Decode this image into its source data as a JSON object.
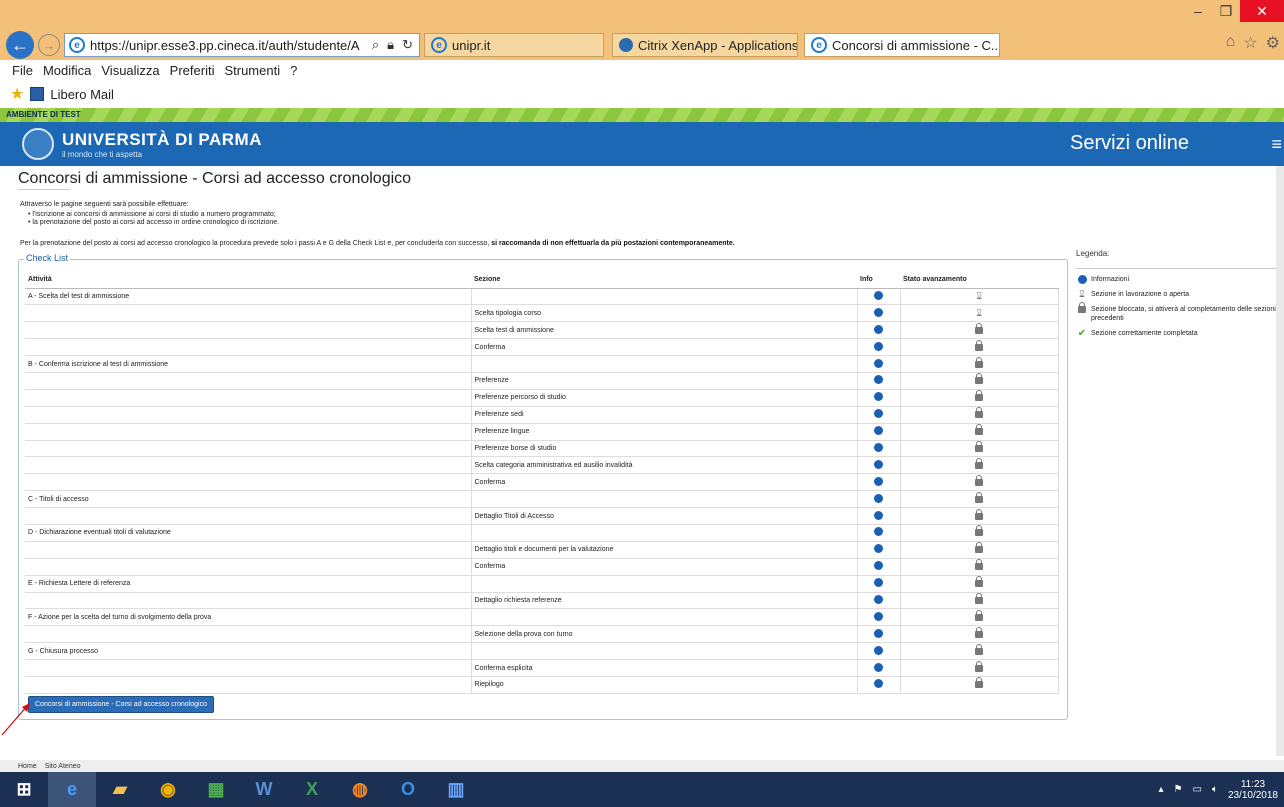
{
  "browser": {
    "url": "https://unipr.esse3.pp.cineca.it/auth/studente/A",
    "tabs": [
      {
        "label": "unipr.it"
      },
      {
        "label": "Citrix XenApp - Applications"
      },
      {
        "label": "Concorsi di ammissione - C...",
        "close": "×"
      }
    ],
    "menu": [
      "File",
      "Modifica",
      "Visualizza",
      "Preferiti",
      "Strumenti",
      "?"
    ],
    "favorite": "Libero Mail"
  },
  "header": {
    "test_banner": "AMBIENTE DI TEST",
    "university": "UNIVERSITÀ DI PARMA",
    "tagline": "il mondo che ti aspetta",
    "services": "Servizi online",
    "brand_color": "#1c68b5"
  },
  "page": {
    "title": "Concorsi di ammissione - Corsi ad accesso cronologico",
    "intro": "Attraverso le pagine seguenti sarà possibile effettuare:",
    "bullets": [
      "l'iscrizione ai concorsi di ammissione ai corsi di studio a numero programmato;",
      "la prenotazione del posto ai corsi ad accesso in ordine cronologico di iscrizione."
    ],
    "note_prefix": "Per la prenotazione del posto ai corsi ad accesso cronologico la procedura prevede solo i passi A e G della Check List e, per concluderla con successo, ",
    "note_bold": "si raccomanda di non effettuarla da più postazioni contemporaneamente.",
    "checklist_label": "Check List",
    "columns": {
      "activity": "Attività",
      "section": "Sezione",
      "info": "Info",
      "status": "Stato avanzamento"
    },
    "rows": [
      {
        "activity": "A - Scelta del test di ammissione",
        "section": "",
        "status": "hourglass"
      },
      {
        "activity": "",
        "section": "Scelta tipologia corso",
        "status": "hourglass"
      },
      {
        "activity": "",
        "section": "Scelta test di ammissione",
        "status": "lock"
      },
      {
        "activity": "",
        "section": "Conferma",
        "status": "lock"
      },
      {
        "activity": "B - Conferma iscrizione al test di ammissione",
        "section": "",
        "status": "lock"
      },
      {
        "activity": "",
        "section": "Preferenze",
        "status": "lock"
      },
      {
        "activity": "",
        "section": "Preferenze percorso di studio",
        "status": "lock"
      },
      {
        "activity": "",
        "section": "Preferenze sedi",
        "status": "lock"
      },
      {
        "activity": "",
        "section": "Preferenze lingue",
        "status": "lock"
      },
      {
        "activity": "",
        "section": "Preferenze borse di studio",
        "status": "lock"
      },
      {
        "activity": "",
        "section": "Scelta categoria amministrativa ed ausilio invalidità",
        "status": "lock"
      },
      {
        "activity": "",
        "section": "Conferma",
        "status": "lock"
      },
      {
        "activity": "C - Titoli di accesso",
        "section": "",
        "status": "lock"
      },
      {
        "activity": "",
        "section": "Dettaglio Titoli di Accesso",
        "status": "lock"
      },
      {
        "activity": "D - Dichiarazione eventuali titoli di valutazione",
        "section": "",
        "status": "lock"
      },
      {
        "activity": "",
        "section": "Dettaglio titoli e documenti per la valutazione",
        "status": "lock"
      },
      {
        "activity": "",
        "section": "Conferma",
        "status": "lock"
      },
      {
        "activity": "E - Richiesta Lettere di referenza",
        "section": "",
        "status": "lock"
      },
      {
        "activity": "",
        "section": "Dettaglio richiesta referenze",
        "status": "lock"
      },
      {
        "activity": "F - Azione per la scelta del turno di svolgimento della prova",
        "section": "",
        "status": "lock"
      },
      {
        "activity": "",
        "section": "Selezione della prova con turno",
        "status": "lock"
      },
      {
        "activity": "G - Chiusura processo",
        "section": "",
        "status": "lock"
      },
      {
        "activity": "",
        "section": "Conferma esplicita",
        "status": "lock"
      },
      {
        "activity": "",
        "section": "Riepilogo",
        "status": "lock"
      }
    ],
    "button": "Concorsi di ammissione - Corsi ad accesso cronologico"
  },
  "legend": {
    "title": "Legenda:",
    "items": [
      {
        "icon": "info-icon",
        "text": "Informazioni"
      },
      {
        "icon": "hourglass-icon",
        "text": "Sezione in lavorazione o aperta"
      },
      {
        "icon": "lock-icon",
        "text": "Sezione bloccata, si attiverà al completamento delle sezioni precedenti"
      },
      {
        "icon": "check-icon",
        "text": "Sezione correttamente completata"
      }
    ]
  },
  "footer": {
    "home": "Home",
    "site": "Sito Ateneo"
  },
  "taskbar": {
    "time": "11:23",
    "date": "23/10/2018"
  }
}
